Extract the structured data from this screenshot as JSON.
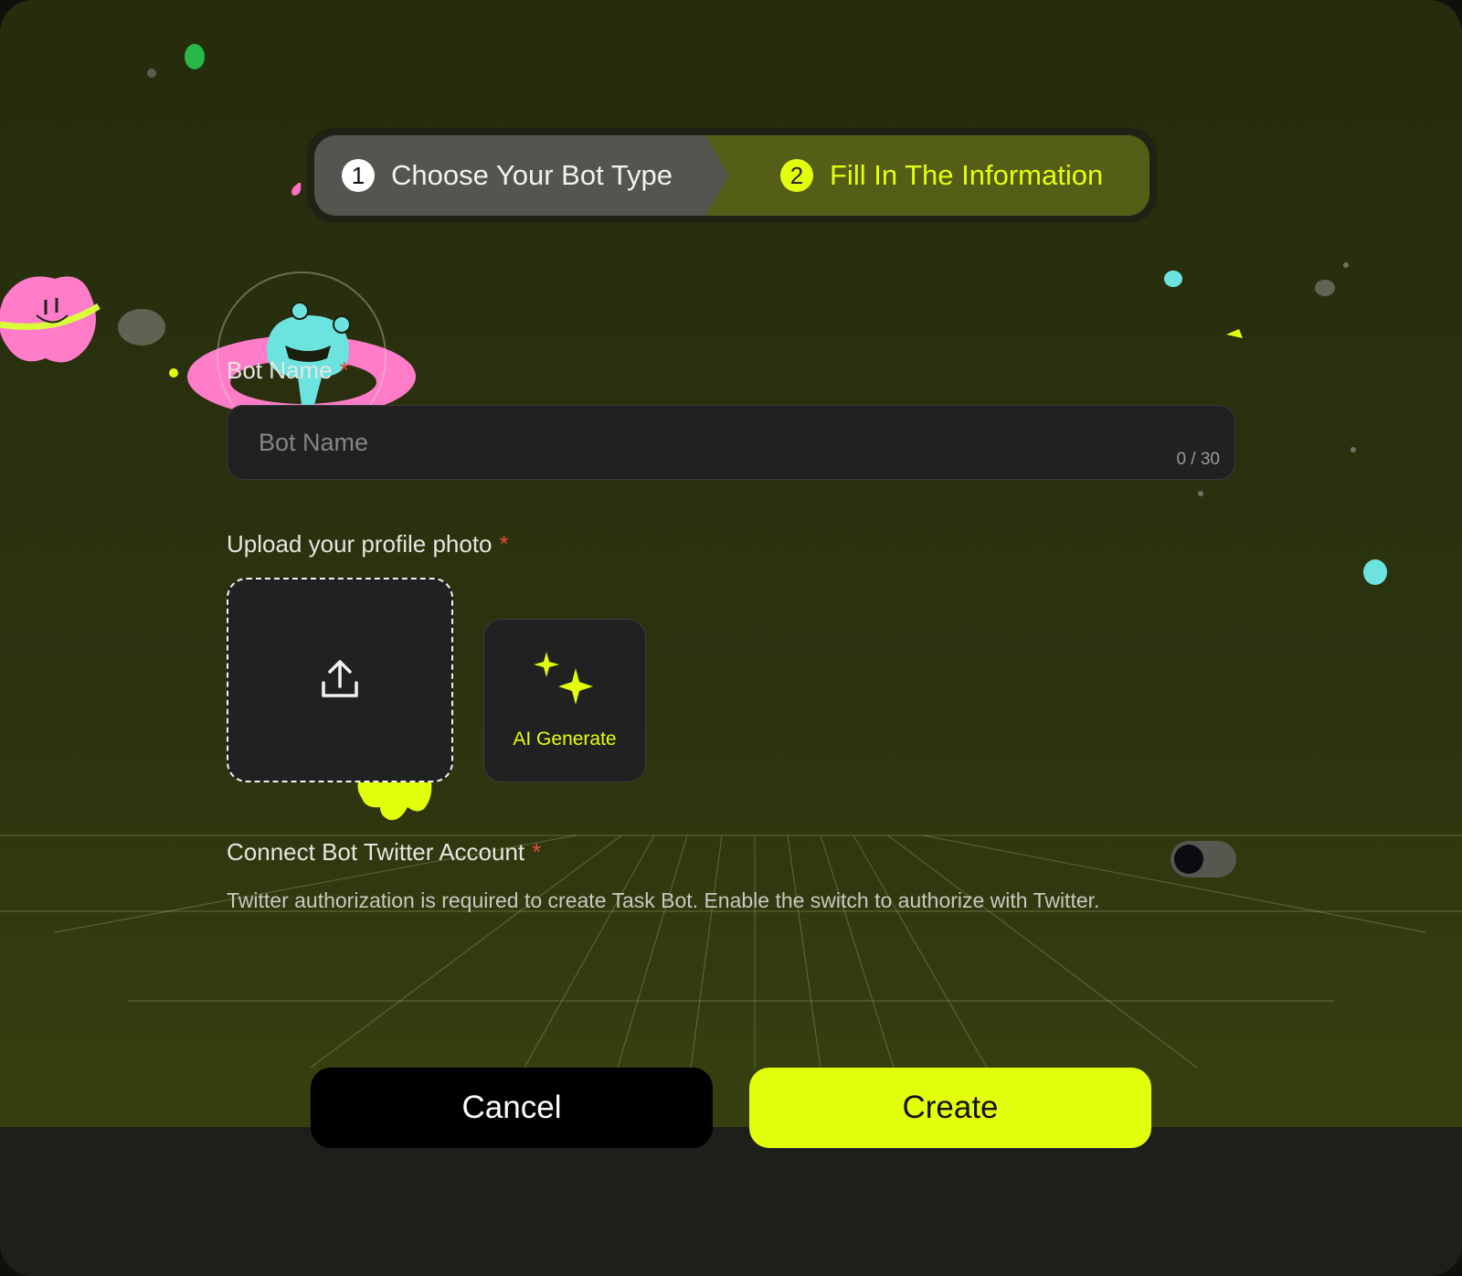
{
  "stepper": {
    "steps": [
      {
        "number": "1",
        "label": "Choose Your Bot Type",
        "state": "completed"
      },
      {
        "number": "2",
        "label": "Fill In The Information",
        "state": "active"
      }
    ]
  },
  "form": {
    "bot_name": {
      "label": "Bot Name",
      "required_mark": "*",
      "placeholder": "Bot Name",
      "value": "",
      "counter": "0 / 30"
    },
    "profile_photo": {
      "label": "Upload your profile photo",
      "required_mark": "*",
      "upload_icon": "upload-icon",
      "ai_generate_label": "AI Generate",
      "ai_icon": "sparkle-icon"
    },
    "twitter": {
      "label": "Connect Bot Twitter Account",
      "required_mark": "*",
      "description": "Twitter authorization is required to create Task Bot. Enable the switch to authorize with Twitter.",
      "toggle_on": false
    }
  },
  "actions": {
    "cancel_label": "Cancel",
    "create_label": "Create"
  },
  "colors": {
    "accent": "#e3ff0c",
    "background": "#2c330f",
    "required": "#e14a3b"
  }
}
